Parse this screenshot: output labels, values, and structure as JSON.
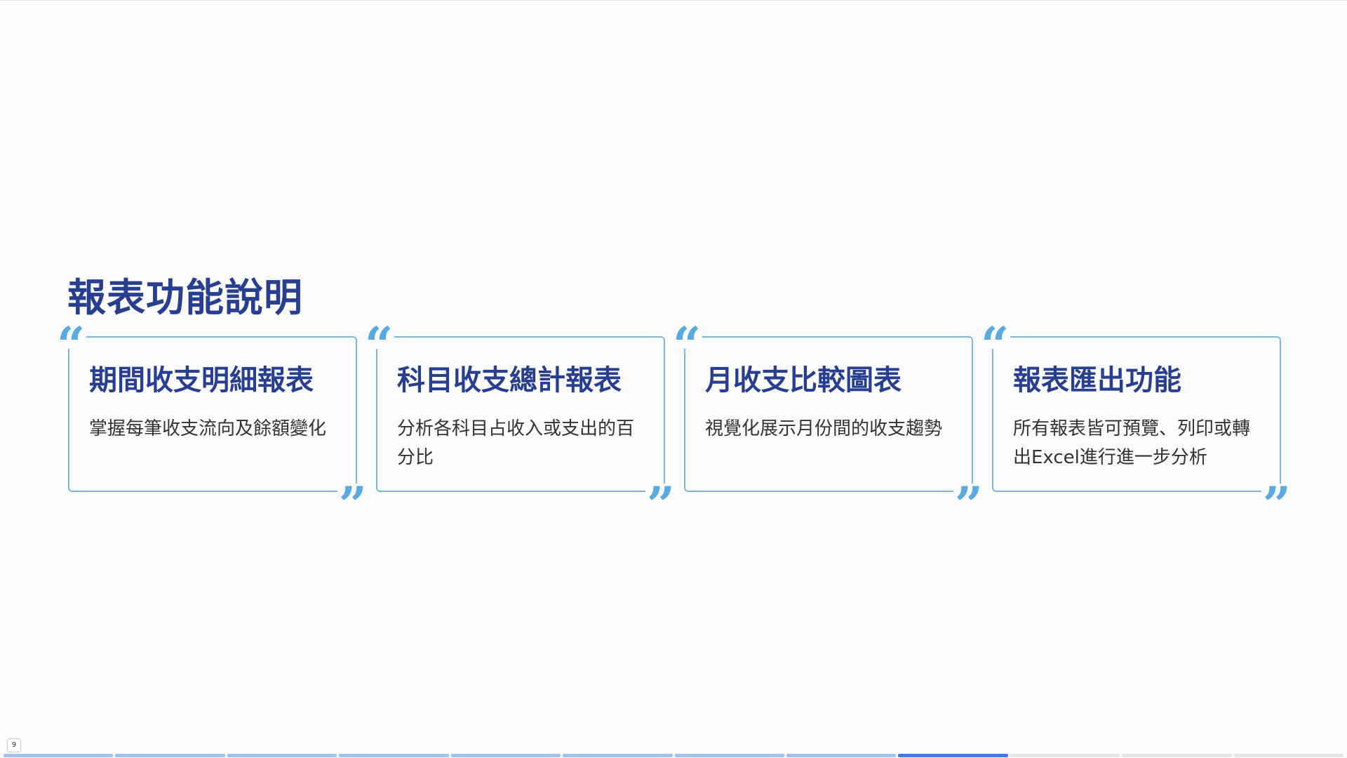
{
  "slide": {
    "title": "報表功能說明",
    "page_number": "9",
    "quote_open": "“",
    "quote_close": "”"
  },
  "cards": [
    {
      "title": "期間收支明細報表",
      "description": "掌握每筆收支流向及餘額變化"
    },
    {
      "title": "科目收支總計報表",
      "description": "分析各科目占收入或支出的百分比"
    },
    {
      "title": "月收支比較圖表",
      "description": "視覺化展示月份間的收支趨勢"
    },
    {
      "title": "報表匯出功能",
      "description": "所有報表皆可預覽、列印或轉出Excel進行進一步分析"
    }
  ],
  "progress": {
    "total_slides": 12,
    "current_slide": 9
  },
  "colors": {
    "title": "#283e91",
    "card_border": "#7cb6de",
    "quote_mark": "#5aa9df",
    "progress_done": "#a3c1f0",
    "progress_active": "#3d7ee6",
    "progress_future": "#e6e6e6"
  }
}
